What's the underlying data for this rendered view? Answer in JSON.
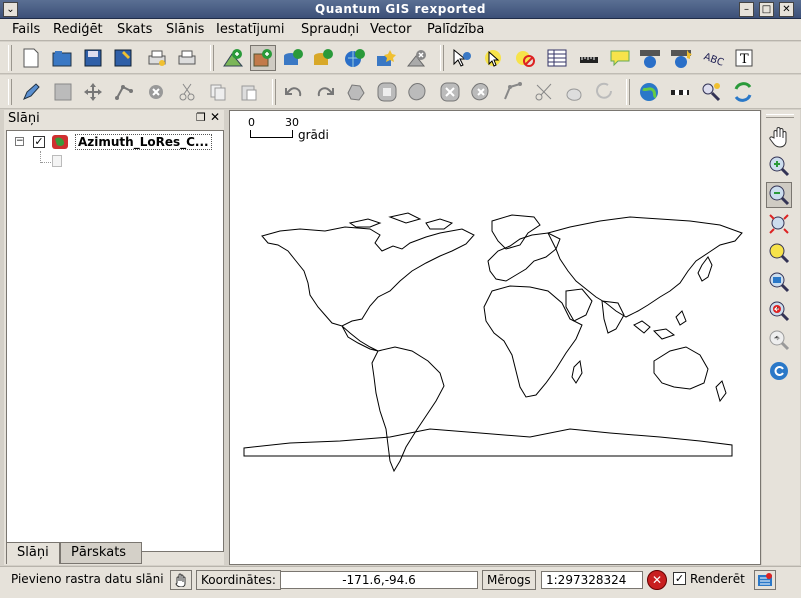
{
  "window": {
    "title": "Quantum GIS rexported"
  },
  "menu": [
    "Fails",
    "Rediģēt",
    "Skats",
    "Slānis",
    "Iestatījumi",
    "Spraudņi",
    "Vector",
    "Palīdzība"
  ],
  "layers_panel": {
    "title": "Slāņi",
    "layer_name": "Azimuth_LoRes_C...",
    "tabs": [
      "Slāņi",
      "Pārskats"
    ]
  },
  "map": {
    "scale_bar": {
      "start": "0",
      "end": "30",
      "unit": "grādi"
    }
  },
  "status": {
    "message": "Pievieno rastra datu slāni",
    "coords_label": "Koordinātes:",
    "coords_value": "-171.6,-94.6",
    "scale_label": "Mērogs",
    "scale_value": "1:297328324",
    "render_label": "Renderēt"
  },
  "colors": {
    "titlebar": "#3c5078",
    "chrome": "#e6e2da",
    "map_background": "#ffffff"
  }
}
